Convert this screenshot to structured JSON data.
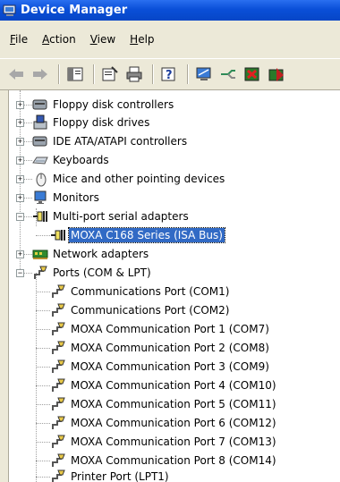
{
  "window": {
    "title": "Device Manager"
  },
  "menu": [
    {
      "label": "File",
      "accel": "F",
      "rest": "ile"
    },
    {
      "label": "Action",
      "accel": "A",
      "rest": "ction"
    },
    {
      "label": "View",
      "accel": "V",
      "rest": "iew"
    },
    {
      "label": "Help",
      "accel": "H",
      "rest": "elp"
    }
  ],
  "toolbar": [
    "back-arrow-icon",
    "forward-arrow-icon",
    "console-tree-icon",
    "properties-icon",
    "print-icon",
    "help-icon",
    "monitor-scan-icon",
    "update-driver-icon",
    "uninstall-icon",
    "disable-icon"
  ],
  "tree": {
    "categories": [
      {
        "label": "Floppy disk controllers",
        "icon": "controller-icon",
        "expanded": false
      },
      {
        "label": "Floppy disk drives",
        "icon": "floppy-drive-icon",
        "expanded": false
      },
      {
        "label": "IDE ATA/ATAPI controllers",
        "icon": "controller-icon",
        "expanded": false
      },
      {
        "label": "Keyboards",
        "icon": "keyboard-icon",
        "expanded": false
      },
      {
        "label": "Mice and other pointing devices",
        "icon": "mouse-icon",
        "expanded": false
      },
      {
        "label": "Monitors",
        "icon": "monitor-icon",
        "expanded": false
      },
      {
        "label": "Multi-port serial adapters",
        "icon": "serial-adapter-icon",
        "expanded": true,
        "children": [
          {
            "label": "MOXA C168 Series (ISA Bus)",
            "selected": true
          }
        ]
      },
      {
        "label": "Network adapters",
        "icon": "network-card-icon",
        "expanded": false
      },
      {
        "label": "Ports (COM & LPT)",
        "icon": "port-icon",
        "expanded": true,
        "children": [
          {
            "label": "Communications Port (COM1)"
          },
          {
            "label": "Communications Port (COM2)"
          },
          {
            "label": "MOXA Communication Port 1 (COM7)"
          },
          {
            "label": "MOXA Communication Port 2 (COM8)"
          },
          {
            "label": "MOXA Communication Port 3 (COM9)"
          },
          {
            "label": "MOXA Communication Port 4 (COM10)"
          },
          {
            "label": "MOXA Communication Port 5 (COM11)"
          },
          {
            "label": "MOXA Communication Port 6 (COM12)"
          },
          {
            "label": "MOXA Communication Port 7 (COM13)"
          },
          {
            "label": "MOXA Communication Port 8 (COM14)"
          },
          {
            "label": "Printer Port (LPT1)"
          }
        ]
      }
    ]
  },
  "colors": {
    "titlebar": "#0a4fd8",
    "selection": "#316ac5",
    "chrome": "#ece9d8"
  }
}
